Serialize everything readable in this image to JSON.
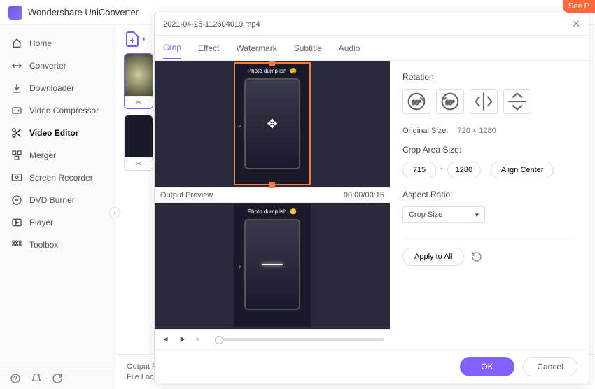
{
  "app": {
    "title": "Wondershare UniConverter",
    "see_label": "See P"
  },
  "sidebar": {
    "items": [
      {
        "label": "Home"
      },
      {
        "label": "Converter"
      },
      {
        "label": "Downloader"
      },
      {
        "label": "Video Compressor"
      },
      {
        "label": "Video Editor"
      },
      {
        "label": "Merger"
      },
      {
        "label": "Screen Recorder"
      },
      {
        "label": "DVD Burner"
      },
      {
        "label": "Player"
      },
      {
        "label": "Toolbox"
      }
    ],
    "active_index": 4
  },
  "bottom": {
    "output_label": "Output F",
    "file_label": "File Loca"
  },
  "modal": {
    "filename": "2021-04-25-112604019.mp4",
    "tabs": [
      "Crop",
      "Effect",
      "Watermark",
      "Subtitle",
      "Audio"
    ],
    "active_tab": 0,
    "preview": {
      "output_label": "Output Preview",
      "timecode": "00:00/00:15",
      "frame_text": "Photo dump ish",
      "frame_emoji": "😏"
    },
    "settings": {
      "rotation_label": "Rotation:",
      "rotation_buttons": [
        "90°",
        "90°",
        "flip-h",
        "flip-v"
      ],
      "original_size_label": "Original Size:",
      "original_size_value": "720 × 1280",
      "crop_area_label": "Crop Area Size:",
      "crop_w": "715",
      "crop_h": "1280",
      "align_center": "Align Center",
      "aspect_label": "Aspect Ratio:",
      "aspect_value": "Crop Size",
      "apply_all": "Apply to All"
    },
    "footer": {
      "ok": "OK",
      "cancel": "Cancel"
    }
  }
}
